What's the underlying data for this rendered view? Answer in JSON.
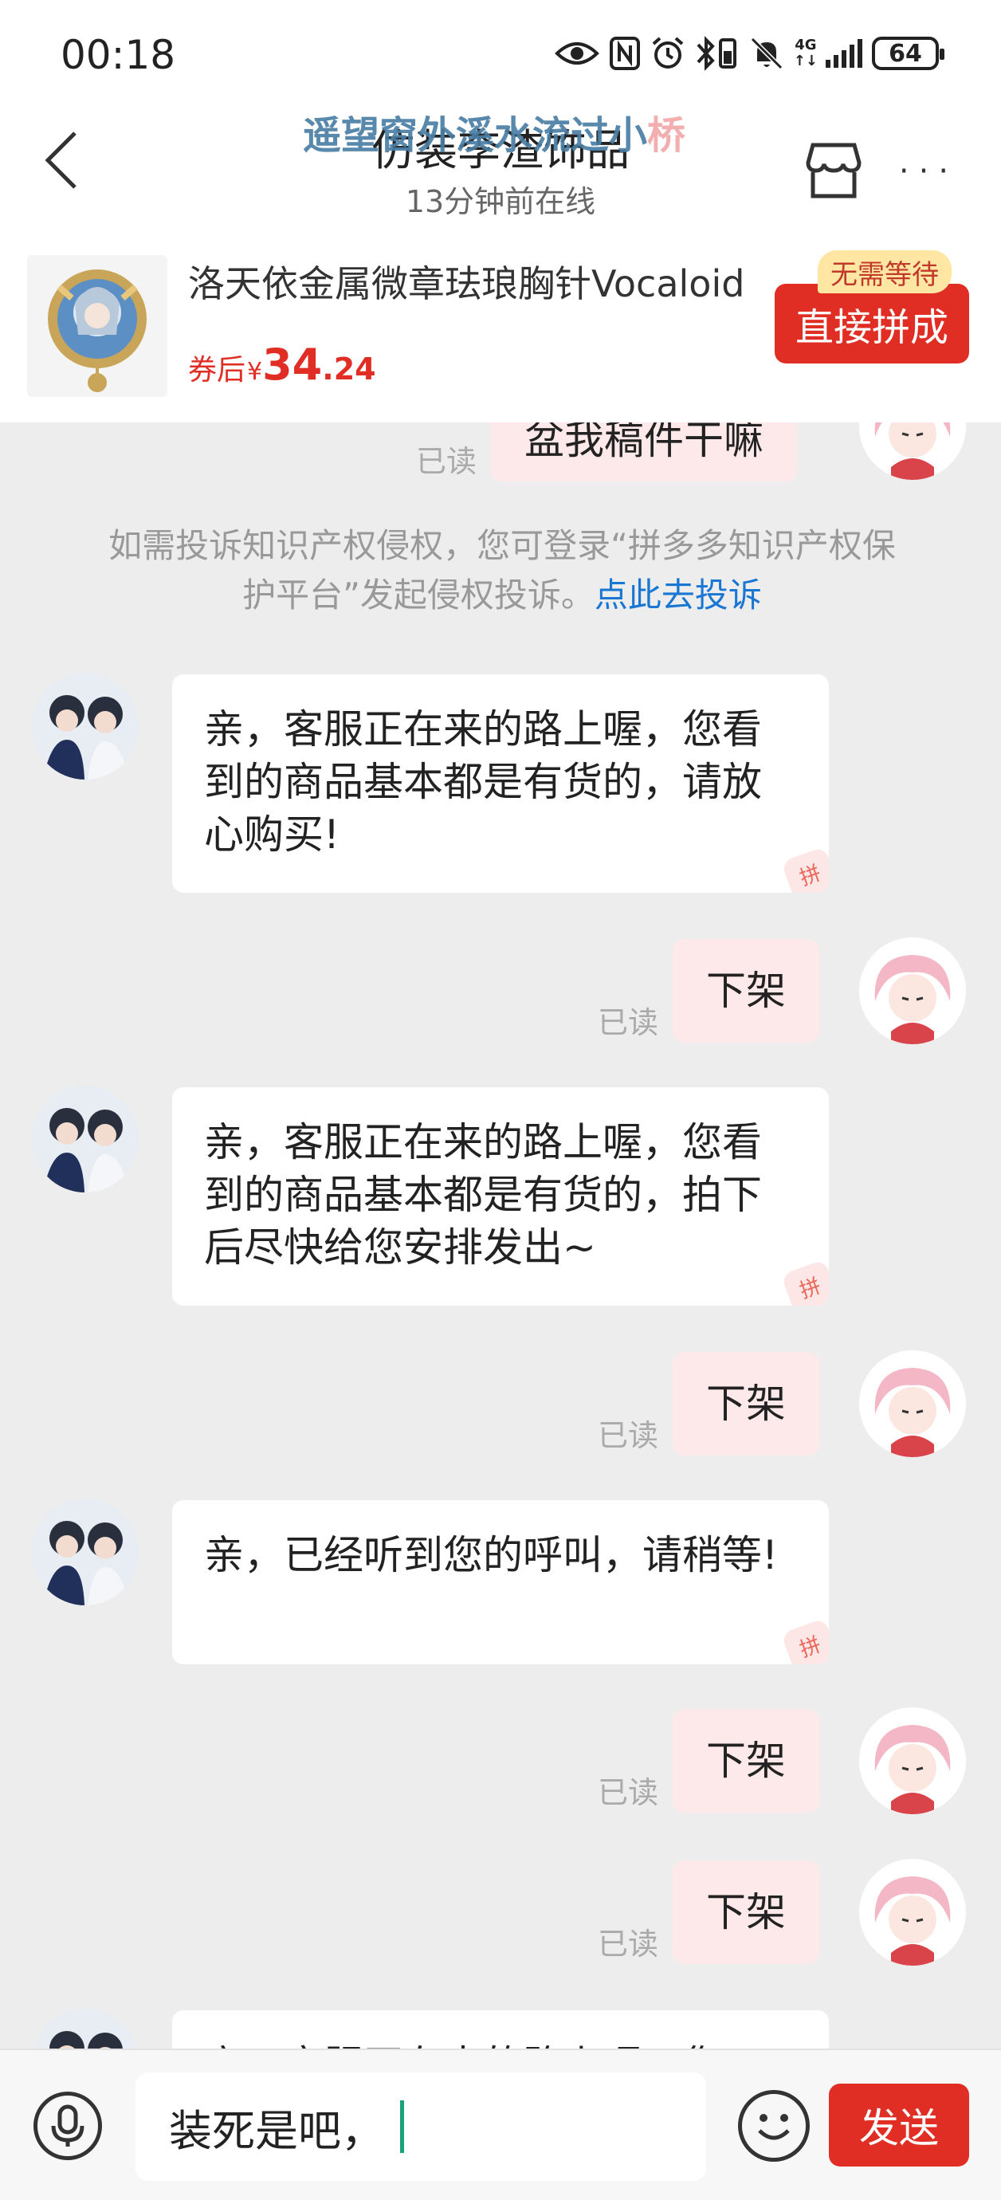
{
  "status_bar": {
    "time": "00:18",
    "network": "4G",
    "battery": "64",
    "icons": [
      "eye-icon",
      "nfc-icon",
      "alarm-icon",
      "bluetooth-battery-icon",
      "mute-icon",
      "signal-icon",
      "battery-icon"
    ]
  },
  "header": {
    "overlay_name": "遥望窗外溪水流过小",
    "overlay_name_tail": "桥",
    "title": "仿装李渣饰品",
    "subtitle": "13分钟前在线",
    "back_icon": "back-icon",
    "store_icon": "store-icon",
    "more_label": "···"
  },
  "product": {
    "title": "洛天依金属微章珐琅胸针Vocaloid",
    "price_prefix": "券后",
    "currency": "¥",
    "price_int": "34",
    "price_dec": ".24",
    "badge": "无需等待",
    "buy_label": "直接拼成"
  },
  "chat": {
    "top_partial": {
      "text": "盆我稿件干嘛",
      "read": "已读"
    },
    "notice": {
      "text": "如需投诉知识产权侵权，您可登录“拼多多知识产权保护平台”发起侵权投诉。",
      "link": "点此去投诉"
    },
    "messages": [
      {
        "from": "shop",
        "text": "亲，客服正在来的路上喔，您看到的商品基本都是有货的，请放心购买!"
      },
      {
        "from": "user",
        "text": "下架",
        "read": "已读"
      },
      {
        "from": "shop",
        "text": "亲，客服正在来的路上喔，您看到的商品基本都是有货的，拍下后尽快给您安排发出~"
      },
      {
        "from": "user",
        "text": "下架",
        "read": "已读"
      },
      {
        "from": "shop",
        "text": "亲，已经听到您的呼叫，请稍等!"
      },
      {
        "from": "user",
        "text": "下架",
        "read": "已读"
      },
      {
        "from": "user",
        "text": "下架",
        "read": "已读"
      },
      {
        "from": "shop",
        "text": "亲，客服正在来的路上喔，您"
      }
    ],
    "watermark": "拼"
  },
  "input_bar": {
    "text": "装死是吧，",
    "send_label": "发送",
    "mic_icon": "microphone-icon",
    "emoji_icon": "emoji-icon"
  },
  "colors": {
    "brand_red": "#e02e24",
    "chat_bg": "#ededed",
    "user_bubble": "#fde9e9",
    "link_blue": "#1976d2"
  }
}
